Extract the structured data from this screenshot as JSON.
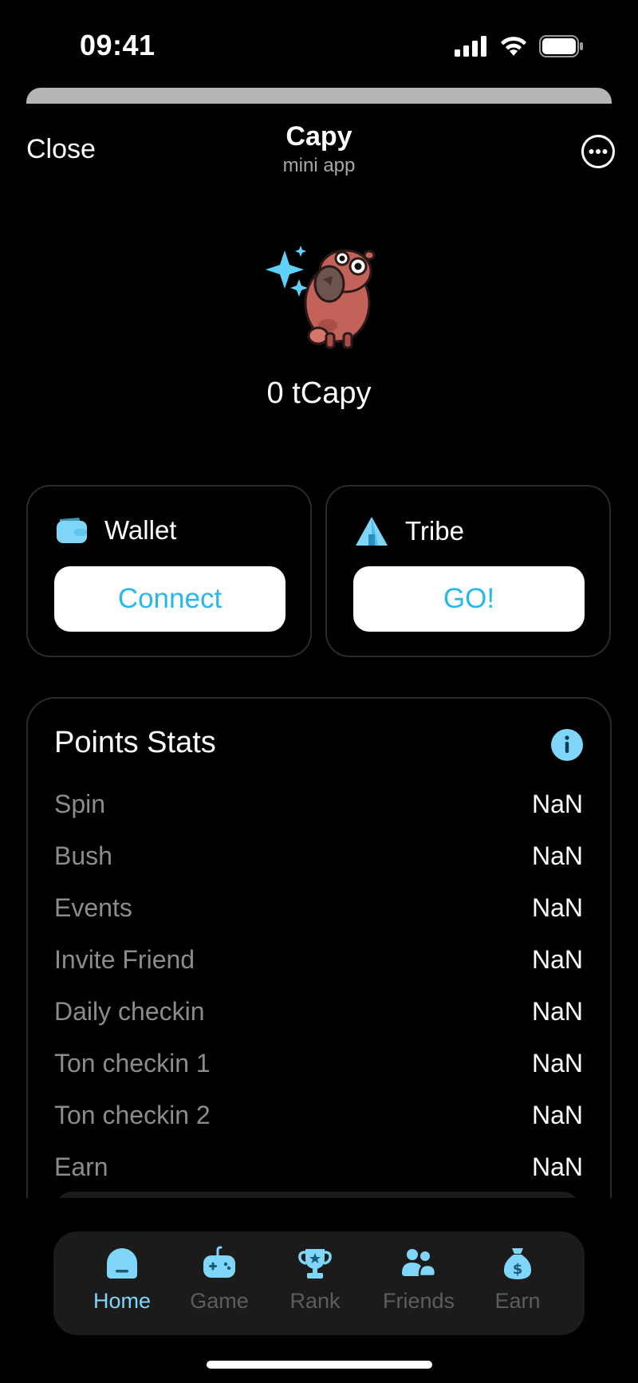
{
  "status_bar": {
    "time": "09:41"
  },
  "header": {
    "close_label": "Close",
    "title": "Capy",
    "subtitle": "mini app"
  },
  "balance": {
    "text": "0 tCapy"
  },
  "cards": {
    "wallet": {
      "label": "Wallet",
      "button": "Connect"
    },
    "tribe": {
      "label": "Tribe",
      "button": "GO!"
    }
  },
  "stats": {
    "title": "Points Stats",
    "rows": [
      {
        "label": "Spin",
        "value": "NaN"
      },
      {
        "label": "Bush",
        "value": "NaN"
      },
      {
        "label": "Events",
        "value": "NaN"
      },
      {
        "label": "Invite Friend",
        "value": "NaN"
      },
      {
        "label": "Daily checkin",
        "value": "NaN"
      },
      {
        "label": "Ton checkin 1",
        "value": "NaN"
      },
      {
        "label": "Ton checkin 2",
        "value": "NaN"
      },
      {
        "label": "Earn",
        "value": "NaN"
      }
    ]
  },
  "nav": {
    "items": [
      {
        "label": "Home",
        "icon": "home-icon",
        "active": true
      },
      {
        "label": "Game",
        "icon": "gamepad-icon",
        "active": false
      },
      {
        "label": "Rank",
        "icon": "trophy-icon",
        "active": false
      },
      {
        "label": "Friends",
        "icon": "friends-icon",
        "active": false
      },
      {
        "label": "Earn",
        "icon": "money-bag-icon",
        "active": false
      }
    ]
  },
  "colors": {
    "accent": "#29b7ee",
    "accent_light": "#7fd6f8",
    "background": "#000000",
    "card_border": "#2a2a2a",
    "nav_bg": "#1b1b1b"
  }
}
